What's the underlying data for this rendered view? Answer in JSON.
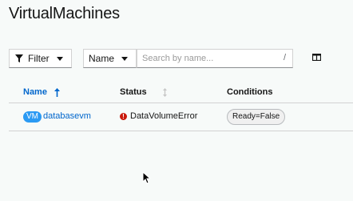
{
  "page": {
    "title": "VirtualMachines"
  },
  "toolbar": {
    "filter_label": "Filter",
    "filter_icon": "filter-icon",
    "attribute_select_value": "Name",
    "search_placeholder": "Search by name...",
    "search_value": "",
    "search_shortcut_hint": "/",
    "columns_icon": "manage-columns-icon"
  },
  "table": {
    "columns": [
      "Name",
      "Status",
      "Conditions"
    ],
    "sorted_column": "Name",
    "sort_direction": "ascending",
    "rows": [
      {
        "badge": "VM",
        "name": "databasevm",
        "status": "DataVolumeError",
        "status_icon": "error-circle-icon",
        "conditions": [
          "Ready=False"
        ]
      }
    ]
  },
  "colors": {
    "link": "#0066cc",
    "badge_bg": "#2b9af3",
    "error": "#c9190b",
    "background": "#f7faf9"
  }
}
